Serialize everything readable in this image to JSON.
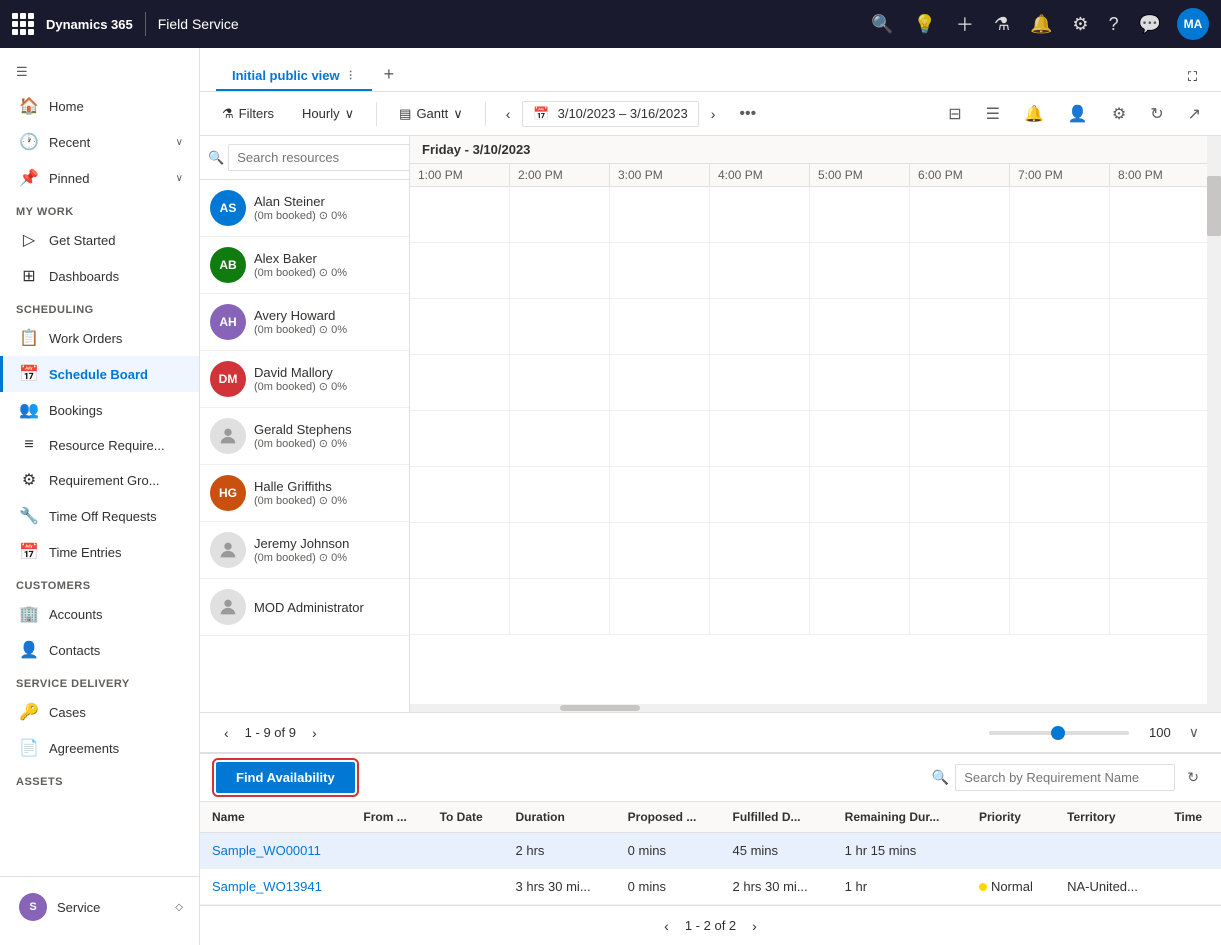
{
  "topbar": {
    "brand": "Dynamics 365",
    "module": "Field Service",
    "avatar_initials": "MA"
  },
  "sidebar": {
    "toggle_icon": "☰",
    "sections": [
      {
        "items": [
          {
            "label": "Home",
            "icon": "🏠",
            "active": false
          },
          {
            "label": "Recent",
            "icon": "🕐",
            "active": false,
            "chevron": true
          },
          {
            "label": "Pinned",
            "icon": "📌",
            "active": false,
            "chevron": true
          }
        ]
      },
      {
        "heading": "My Work",
        "items": [
          {
            "label": "Get Started",
            "icon": "▷",
            "active": false
          },
          {
            "label": "Dashboards",
            "icon": "⊞",
            "active": false
          }
        ]
      },
      {
        "heading": "Scheduling",
        "items": [
          {
            "label": "Work Orders",
            "icon": "📋",
            "active": false
          },
          {
            "label": "Schedule Board",
            "icon": "📅",
            "active": true
          },
          {
            "label": "Bookings",
            "icon": "👥",
            "active": false
          },
          {
            "label": "Resource Require...",
            "icon": "≡",
            "active": false
          },
          {
            "label": "Requirement Gro...",
            "icon": "⚙",
            "active": false
          },
          {
            "label": "Time Off Requests",
            "icon": "🔧",
            "active": false
          },
          {
            "label": "Time Entries",
            "icon": "📅",
            "active": false
          }
        ]
      },
      {
        "heading": "Customers",
        "items": [
          {
            "label": "Accounts",
            "icon": "🏢",
            "active": false
          },
          {
            "label": "Contacts",
            "icon": "👤",
            "active": false
          }
        ]
      },
      {
        "heading": "Service Delivery",
        "items": [
          {
            "label": "Cases",
            "icon": "🔑",
            "active": false
          },
          {
            "label": "Agreements",
            "icon": "📄",
            "active": false
          }
        ]
      },
      {
        "heading": "Assets",
        "items": []
      }
    ],
    "bottom": {
      "avatar_initials": "S",
      "label": "Service"
    }
  },
  "tab_bar": {
    "tab_label": "Initial public view",
    "more_icon": "⋮",
    "add_icon": "+"
  },
  "toolbar": {
    "filter_label": "Filters",
    "view_label": "Hourly",
    "gantt_label": "Gantt",
    "date_range": "3/10/2023 – 3/16/2023",
    "more_icon": "•••",
    "nav_prev": "‹",
    "nav_next": "›"
  },
  "schedule": {
    "date_header": "Friday - 3/10/2023",
    "time_columns": [
      "1:00 PM",
      "2:00 PM",
      "3:00 PM",
      "4:00 PM",
      "5:00 PM",
      "6:00 PM",
      "7:00 PM",
      "8:00 PM"
    ],
    "resources": [
      {
        "name": "Alan Steiner",
        "meta": "(0m booked) ⊙ 0%",
        "avatar_color": "av-1",
        "initials": "AS",
        "has_photo": false
      },
      {
        "name": "Alex Baker",
        "meta": "(0m booked) ⊙ 0%",
        "avatar_color": "av-2",
        "initials": "AB",
        "has_photo": false
      },
      {
        "name": "Avery Howard",
        "meta": "(0m booked) ⊙ 0%",
        "avatar_color": "av-3",
        "initials": "AH",
        "has_photo": false
      },
      {
        "name": "David Mallory",
        "meta": "(0m booked) ⊙ 0%",
        "avatar_color": "av-4",
        "initials": "DM",
        "has_photo": false
      },
      {
        "name": "Gerald Stephens",
        "meta": "(0m booked) ⊙ 0%",
        "avatar_color": "av-grey",
        "initials": "",
        "has_photo": false,
        "generic": true
      },
      {
        "name": "Halle Griffiths",
        "meta": "(0m booked) ⊙ 0%",
        "avatar_color": "av-5",
        "initials": "HG",
        "has_photo": false
      },
      {
        "name": "Jeremy Johnson",
        "meta": "(0m booked) ⊙ 0%",
        "avatar_color": "av-grey",
        "initials": "",
        "has_photo": false,
        "generic": true
      },
      {
        "name": "MOD Administrator",
        "meta": "",
        "avatar_color": "av-grey",
        "initials": "",
        "has_photo": false,
        "generic": true
      }
    ],
    "pagination": {
      "current": "1 - 9 of 9",
      "prev": "‹",
      "next": "›",
      "zoom_value": "100",
      "expand_icon": "∨"
    }
  },
  "bottom_panel": {
    "find_availability_label": "Find Availability",
    "search_placeholder": "Search by Requirement Name",
    "refresh_icon": "↻",
    "table_headers": [
      "Name",
      "From ...",
      "To Date",
      "Duration",
      "Proposed ...",
      "Fulfilled D...",
      "Remaining Dur...",
      "Priority",
      "Territory",
      "Time"
    ],
    "rows": [
      {
        "name": "Sample_WO00011",
        "from": "",
        "to_date": "",
        "duration": "2 hrs",
        "proposed": "0 mins",
        "fulfilled": "45 mins",
        "remaining": "1 hr 15 mins",
        "priority": "",
        "territory": "",
        "time": "",
        "selected": true
      },
      {
        "name": "Sample_WO13941",
        "from": "",
        "to_date": "",
        "duration": "3 hrs 30 mi...",
        "proposed": "0 mins",
        "fulfilled": "2 hrs 30 mi...",
        "remaining": "1 hr",
        "priority": "Normal",
        "priority_dot": true,
        "territory": "NA-United...",
        "time": "",
        "selected": false
      }
    ],
    "pagination": {
      "prev": "‹",
      "text": "1 - 2 of 2",
      "next": "›"
    }
  }
}
